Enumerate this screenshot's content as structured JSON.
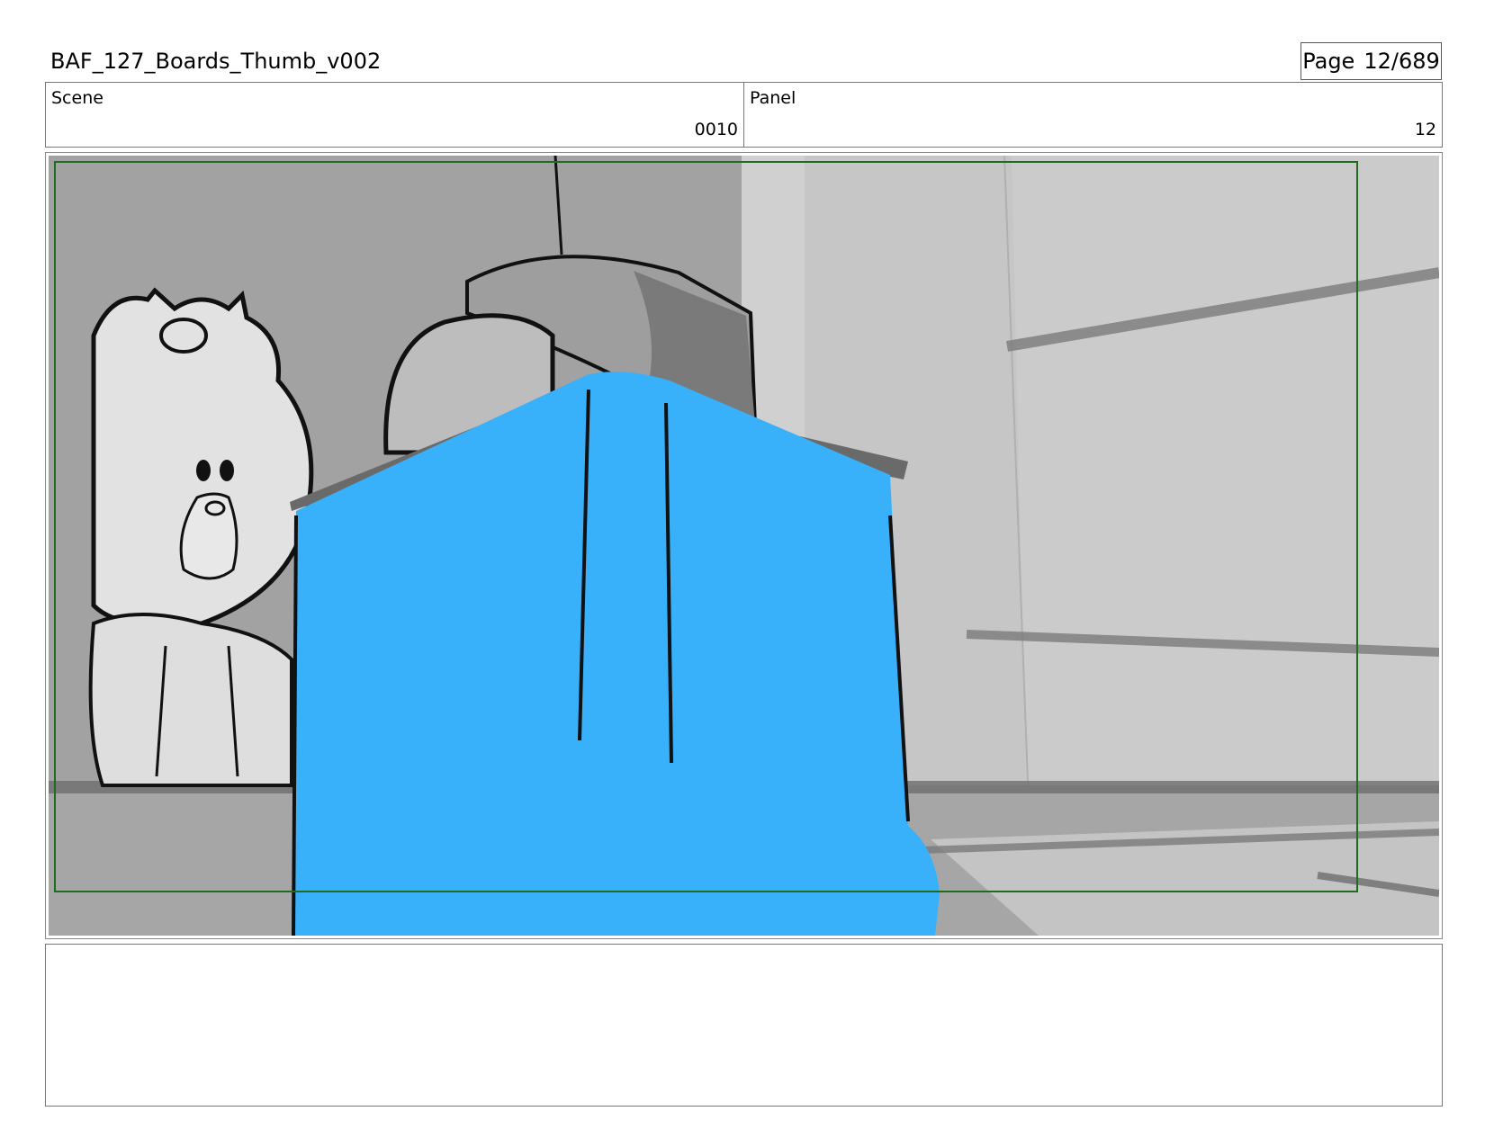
{
  "header": {
    "document_title": "BAF_127_Boards_Thumb_v002",
    "page_label": "Page",
    "page_number": "12/689"
  },
  "info": {
    "scene_label": "Scene",
    "scene_value": "0010",
    "panel_label": "Panel",
    "panel_value": "12"
  },
  "panel_image": {
    "description_icon": "storyboard-sketch",
    "accent_color": "#38b0fa",
    "safe_area_color": "#1f6b1f"
  },
  "notes": {
    "text": ""
  }
}
